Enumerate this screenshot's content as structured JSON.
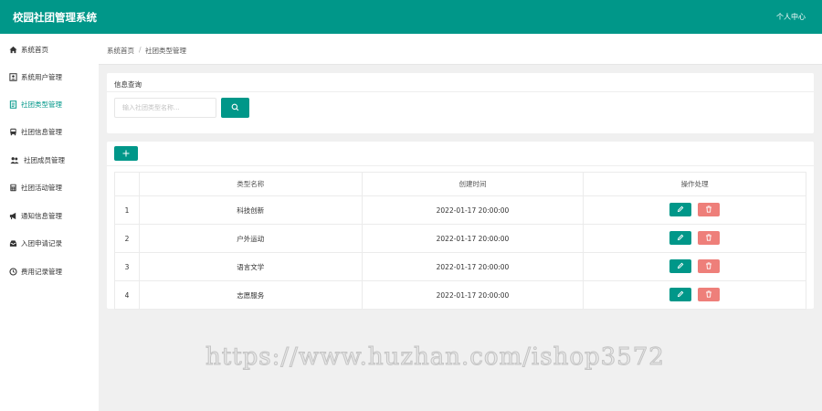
{
  "header": {
    "app_title": "校园社团管理系统",
    "user_center": "个人中心"
  },
  "sidebar": {
    "items": [
      {
        "label": "系统首页",
        "icon": "home-icon"
      },
      {
        "label": "系统用户管理",
        "icon": "user-card-icon"
      },
      {
        "label": "社团类型管理",
        "icon": "document-icon",
        "active": true
      },
      {
        "label": "社团信息管理",
        "icon": "bus-icon"
      },
      {
        "label": "社团成员管理",
        "icon": "users-icon"
      },
      {
        "label": "社团活动管理",
        "icon": "calculator-icon"
      },
      {
        "label": "通知信息管理",
        "icon": "megaphone-icon"
      },
      {
        "label": "入团申请记录",
        "icon": "inbox-icon"
      },
      {
        "label": "费用记录管理",
        "icon": "clock-icon"
      }
    ]
  },
  "breadcrumb": {
    "home": "系统首页",
    "separator": "/",
    "current": "社团类型管理"
  },
  "search_card": {
    "title": "信息查询",
    "placeholder": "输入社团类型名称..."
  },
  "table": {
    "headers": [
      "",
      "类型名称",
      "创建时间",
      "操作处理"
    ],
    "rows": [
      {
        "index": "1",
        "name": "科技创新",
        "created": "2022-01-17 20:00:00"
      },
      {
        "index": "2",
        "name": "户外运动",
        "created": "2022-01-17 20:00:00"
      },
      {
        "index": "3",
        "name": "语言文学",
        "created": "2022-01-17 20:00:00"
      },
      {
        "index": "4",
        "name": "志愿服务",
        "created": "2022-01-17 20:00:00"
      }
    ]
  },
  "watermark": "https://www.huzhan.com/ishop3572",
  "colors": {
    "primary": "#009789",
    "danger": "#ee7f7a",
    "background": "#f0f0f0"
  }
}
